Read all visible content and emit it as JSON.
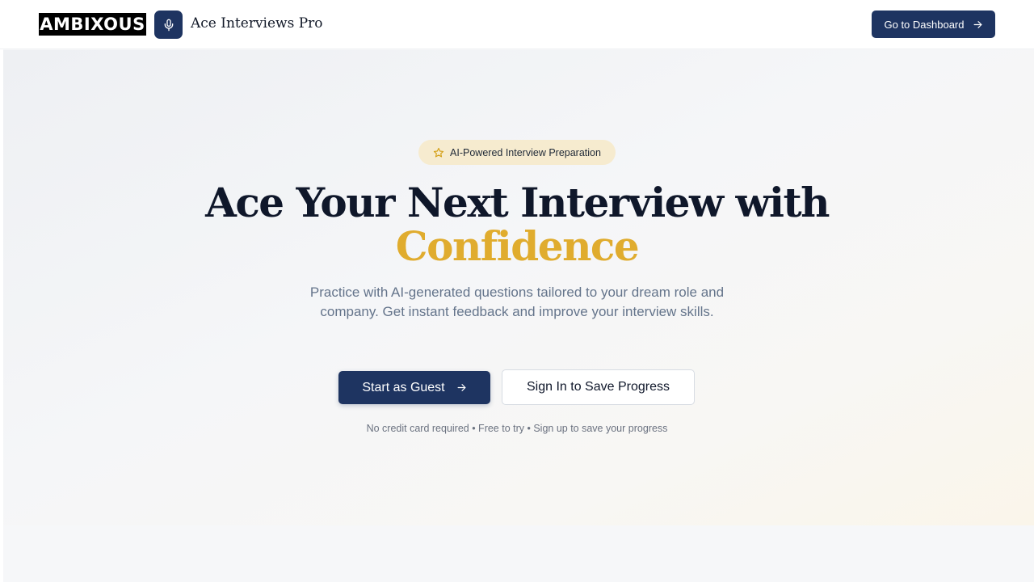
{
  "header": {
    "logo_text": "AMBIXOUS",
    "app_name": "Ace Interviews Pro",
    "dashboard_label": "Go to Dashboard"
  },
  "hero": {
    "badge": "AI-Powered Interview Preparation",
    "headline_line1": "Ace Your Next Interview with",
    "headline_accent": "Confidence",
    "subtext": "Practice with AI-generated questions tailored to your dream role and company. Get instant feedback and improve your interview skills.",
    "primary_cta": "Start as Guest",
    "secondary_cta": "Sign In to Save Progress",
    "footnote": "No credit card required • Free to try • Sign up to save your progress"
  },
  "icons": {
    "mic": "mic-icon",
    "arrow": "arrow-right-icon",
    "star": "star-icon"
  },
  "colors": {
    "brand_navy": "#1e3461",
    "accent_gold": "#e0ac2e",
    "badge_bg": "#f6ebcf",
    "muted_text": "#64748b"
  }
}
